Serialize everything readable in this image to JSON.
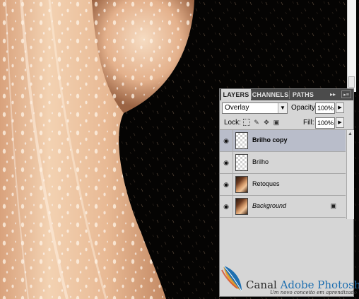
{
  "panel": {
    "tabs": [
      {
        "label": "LAYERS",
        "active": true
      },
      {
        "label": "CHANNELS",
        "active": false
      },
      {
        "label": "PATHS",
        "active": false
      }
    ],
    "collapse_icon": "double-chevron-right-icon",
    "menu_icon": "panel-menu-icon",
    "blend_mode": "Overlay",
    "opacity_label": "Opacity:",
    "opacity_value": "100%",
    "lock_label": "Lock:",
    "fill_label": "Fill:",
    "fill_value": "100%",
    "layers": [
      {
        "name": "Brilho copy",
        "selected": true,
        "thumb": "transparent"
      },
      {
        "name": "Brilho",
        "selected": false,
        "thumb": "transparent"
      },
      {
        "name": "Retoques",
        "selected": false,
        "thumb": "image"
      },
      {
        "name": "Background",
        "selected": false,
        "thumb": "image",
        "locked": true
      }
    ]
  },
  "watermark": {
    "title_prefix": "Canal ",
    "title_brand": "Adobe Photoshop",
    "subtitle": "Um novo conceito em aprendizado"
  },
  "colors": {
    "panel_bg": "#d6d6d6",
    "tab_bar": "#4b4b4b",
    "selected_layer": "#b9bdca",
    "brand_blue": "#1e6fb0"
  }
}
